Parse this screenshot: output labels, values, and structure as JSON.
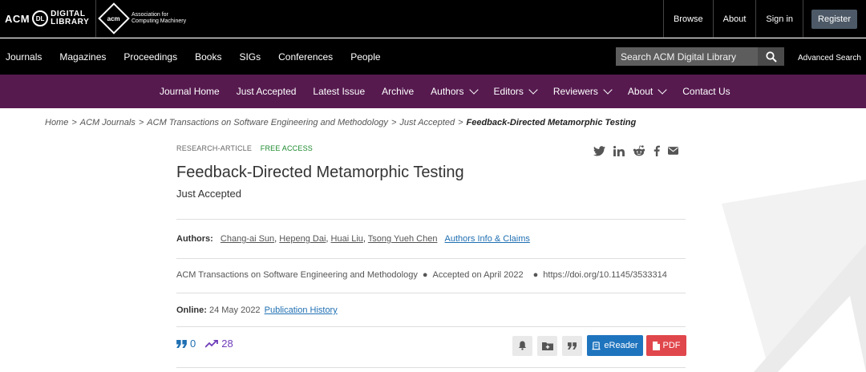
{
  "topbar": {
    "logo_acm": "ACM",
    "logo_dl_mark": "DL",
    "logo_digital": "DIGITAL",
    "logo_library": "LIBRARY",
    "acm_mark": "acm",
    "assoc_line1": "Association for",
    "assoc_line2": "Computing Machinery",
    "links": [
      "Browse",
      "About",
      "Sign in"
    ],
    "register": "Register"
  },
  "mainnav": {
    "items": [
      "Journals",
      "Magazines",
      "Proceedings",
      "Books",
      "SIGs",
      "Conferences",
      "People"
    ],
    "search_placeholder": "Search ACM Digital Library",
    "advanced": "Advanced Search"
  },
  "journal_nav": {
    "items": [
      {
        "label": "Journal Home",
        "dropdown": false
      },
      {
        "label": "Just Accepted",
        "dropdown": false
      },
      {
        "label": "Latest Issue",
        "dropdown": false
      },
      {
        "label": "Archive",
        "dropdown": false
      },
      {
        "label": "Authors",
        "dropdown": true
      },
      {
        "label": "Editors",
        "dropdown": true
      },
      {
        "label": "Reviewers",
        "dropdown": true
      },
      {
        "label": "About",
        "dropdown": true
      },
      {
        "label": "Contact Us",
        "dropdown": false
      }
    ]
  },
  "breadcrumb": {
    "items": [
      "Home",
      "ACM Journals",
      "ACM Transactions on Software Engineering and Methodology",
      "Just Accepted"
    ],
    "current": "Feedback-Directed Metamorphic Testing"
  },
  "article": {
    "type": "RESEARCH-ARTICLE",
    "access": "FREE ACCESS",
    "title": "Feedback-Directed Metamorphic Testing",
    "subtitle": "Just Accepted",
    "authors_label": "Authors:",
    "authors": [
      "Chang-ai Sun",
      "Hepeng Dai",
      "Huai Liu",
      "Tsong Yueh Chen"
    ],
    "authors_info": "Authors Info & Claims",
    "journal": "ACM Transactions on Software Engineering and Methodology",
    "accepted": "Accepted on April 2022",
    "doi": "https://doi.org/10.1145/3533314",
    "online_label": "Online:",
    "online_date": "24 May 2022",
    "pub_history": "Publication History",
    "citations": "0",
    "downloads": "28",
    "ereader": "eReader",
    "pdf": "PDF"
  }
}
